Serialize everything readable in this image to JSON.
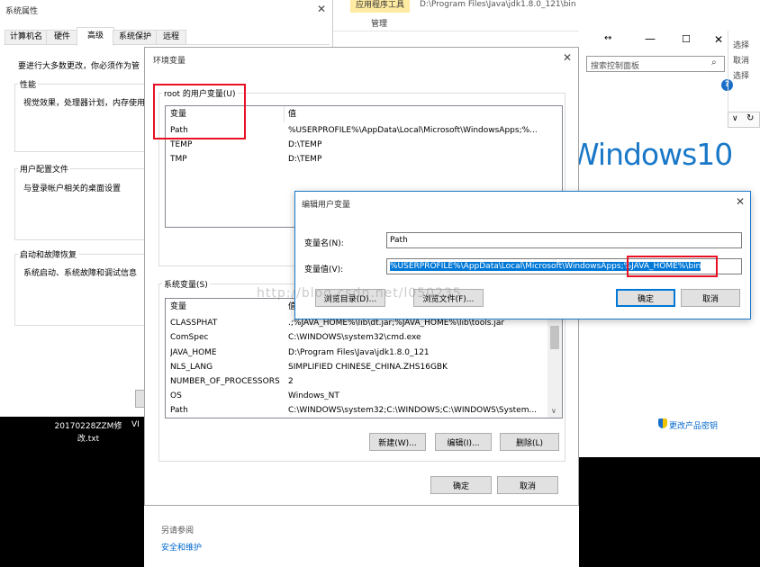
{
  "sysprops": {
    "title": "系统属性",
    "tabs": [
      "计算机名",
      "硬件",
      "高级",
      "系统保护",
      "远程"
    ],
    "admin_note": "要进行大多数更改，你必须作为管",
    "perf_title": "性能",
    "perf_desc": "视觉效果，处理器计划，内存使用",
    "profile_title": "用户配置文件",
    "profile_desc": "与登录帐户相关的桌面设置",
    "startup_title": "启动和故障恢复",
    "startup_desc": "系统启动、系统故障和调试信息"
  },
  "explorer": {
    "ribbon_tab": "应用程序工具",
    "ribbon_sub": "管理",
    "path": "D:\\Program Files\\Java\\jdk1.8.0_121\\bin"
  },
  "control_panel": {
    "search_placeholder": "搜索控制面板",
    "windows_logo": "Windows10",
    "right_menu": [
      "选择",
      "取消",
      "选择"
    ],
    "product_key_link": "更改产品密钥",
    "see_also": "另请参阅",
    "security_link": "安全和维护"
  },
  "desktop_file": {
    "name": "20170228ZZM修改.txt",
    "vi": "VI"
  },
  "envvars": {
    "title": "环境变量",
    "user_group_label": "root 的用户变量(U)",
    "col_var": "变量",
    "col_val": "值",
    "user_vars": [
      {
        "name": "Path",
        "value": "%USERPROFILE%\\AppData\\Local\\Microsoft\\WindowsApps;%..."
      },
      {
        "name": "TEMP",
        "value": "D:\\TEMP"
      },
      {
        "name": "TMP",
        "value": "D:\\TEMP"
      }
    ],
    "sys_group_label": "系统变量(S)",
    "sys_vars": [
      {
        "name": "CLASSPHAT",
        "value": ".;%JAVA_HOME%\\lib\\dt.jar;%JAVA_HOME%\\lib\\tools.jar"
      },
      {
        "name": "ComSpec",
        "value": "C:\\WINDOWS\\system32\\cmd.exe"
      },
      {
        "name": "JAVA_HOME",
        "value": "D:\\Program Files\\Java\\jdk1.8.0_121"
      },
      {
        "name": "NLS_LANG",
        "value": "SIMPLIFIED CHINESE_CHINA.ZHS16GBK"
      },
      {
        "name": "NUMBER_OF_PROCESSORS",
        "value": "2"
      },
      {
        "name": "OS",
        "value": "Windows_NT"
      },
      {
        "name": "Path",
        "value": "C:\\WINDOWS\\system32;C:\\WINDOWS;C:\\WINDOWS\\System..."
      }
    ],
    "sys_new": "新建(W)...",
    "sys_edit": "编辑(I)...",
    "sys_delete": "删除(L)",
    "ok": "确定",
    "cancel": "取消"
  },
  "edit_dialog": {
    "title": "编辑用户变量",
    "name_label": "变量名(N):",
    "name_value": "Path",
    "value_label": "变量值(V):",
    "value_text": "%USERPROFILE%\\AppData\\Local\\Microsoft\\WindowsApps;%JAVA_HOME%\\bin",
    "browse_dir": "浏览目录(D)...",
    "browse_file": "浏览文件(F)...",
    "ok": "确定",
    "cancel": "取消"
  },
  "watermark": "http://blog.csdn.net/l050235",
  "colors": {
    "selection": "#0078d7",
    "highlight_box": "#e81123",
    "link": "#0066cc"
  }
}
